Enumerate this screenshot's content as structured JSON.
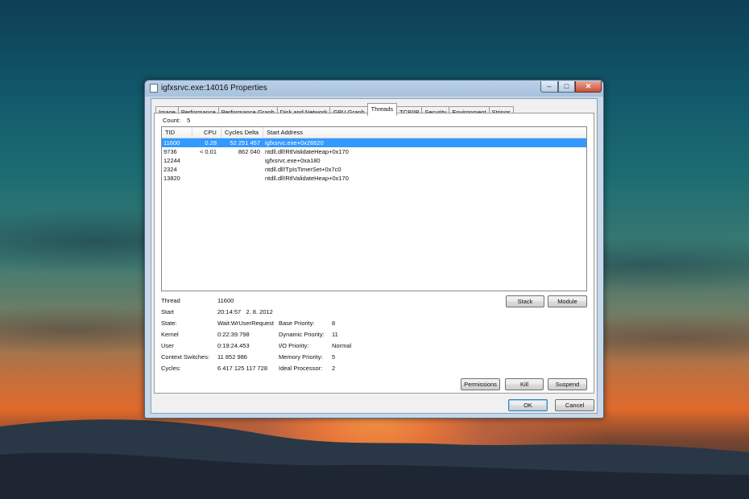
{
  "window": {
    "title": "igfxsrvc.exe:14016 Properties",
    "controls": {
      "minimize": "–",
      "maximize": "□",
      "close": "✕"
    }
  },
  "tabs": [
    {
      "label": "Image"
    },
    {
      "label": "Performance"
    },
    {
      "label": "Performance Graph"
    },
    {
      "label": "Disk and Network"
    },
    {
      "label": "GPU Graph"
    },
    {
      "label": "Threads",
      "active": true
    },
    {
      "label": "TCP/IP"
    },
    {
      "label": "Security"
    },
    {
      "label": "Environment"
    },
    {
      "label": "Strings"
    }
  ],
  "count": {
    "label": "Count:",
    "value": "5"
  },
  "threads_table": {
    "columns": [
      "TID",
      "CPU",
      "Cycles Delta",
      "Start Address"
    ],
    "rows": [
      {
        "tid": "11600",
        "cpu": "0.28",
        "cycles": "52 251 457",
        "start": "igfxsrvc.exe+0x26620",
        "selected": true
      },
      {
        "tid": "9736",
        "cpu": "< 0.01",
        "cycles": "862 040",
        "start": "ntdll.dll!RtlValidateHeap+0x170"
      },
      {
        "tid": "12244",
        "cpu": "",
        "cycles": "",
        "start": "igfxsrvc.exe+0xa180"
      },
      {
        "tid": "2324",
        "cpu": "",
        "cycles": "",
        "start": "ntdll.dll!TpIsTimerSet+0x7c0"
      },
      {
        "tid": "13820",
        "cpu": "",
        "cycles": "",
        "start": "ntdll.dll!RtlValidateHeap+0x170"
      }
    ]
  },
  "details": {
    "thread": {
      "label": "Thread",
      "value": "11600"
    },
    "start": {
      "label": "Start",
      "value": "20:14:57   2. 8. 2012"
    },
    "state": {
      "label": "State:",
      "value": "Wait:WrUserRequest"
    },
    "kernel": {
      "label": "Kernel",
      "value": "0:22:39.798"
    },
    "user": {
      "label": "User",
      "value": "0:19:24.453"
    },
    "context_switches": {
      "label": "Context Switches:",
      "value": "11 852 986"
    },
    "cycles": {
      "label": "Cycles:",
      "value": "6 417 125 117 728"
    },
    "base_priority": {
      "label": "Base Priority:",
      "value": "8"
    },
    "dynamic_priority": {
      "label": "Dynamic Priority:",
      "value": "11"
    },
    "io_priority": {
      "label": "I/O Priority:",
      "value": "Normal"
    },
    "memory_priority": {
      "label": "Memory Priority:",
      "value": "5"
    },
    "ideal_processor": {
      "label": "Ideal Processor:",
      "value": "2"
    }
  },
  "buttons": {
    "stack": "Stack",
    "module": "Module",
    "permissions": "Permissions",
    "kill": "Kill",
    "suspend": "Suspend",
    "ok": "OK",
    "cancel": "Cancel"
  }
}
